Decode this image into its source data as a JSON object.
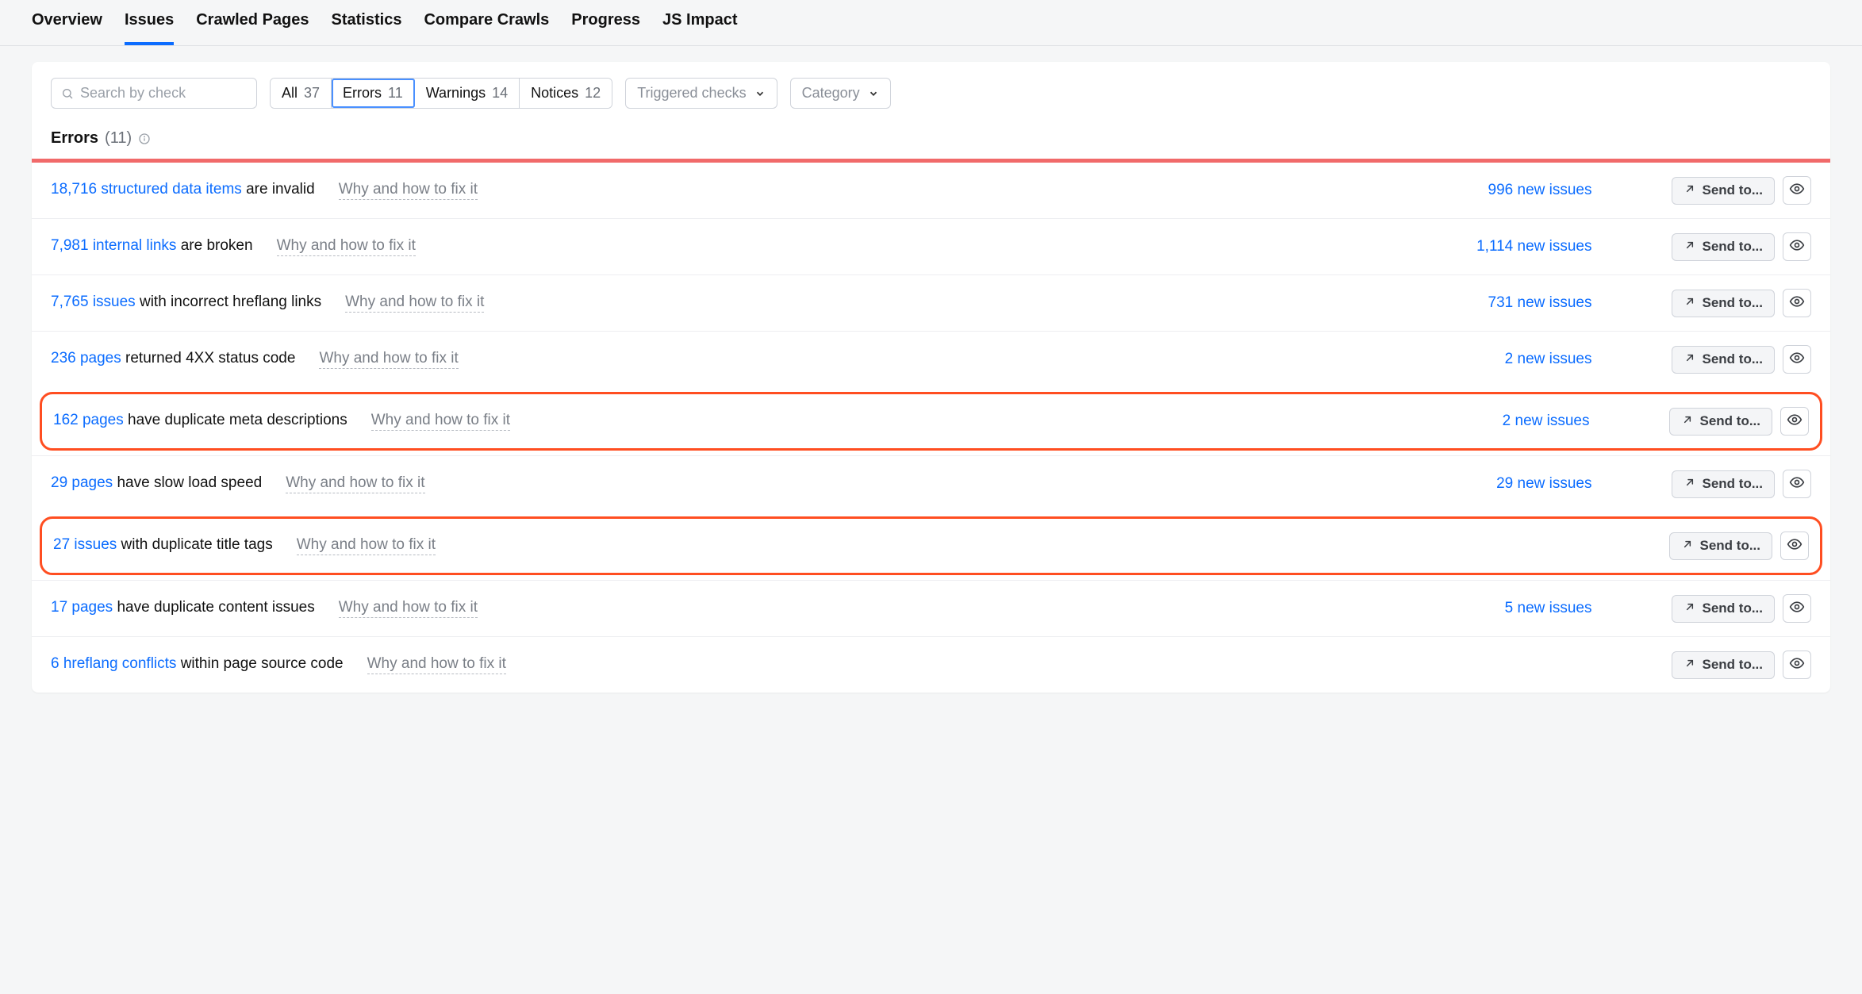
{
  "tabs": [
    {
      "label": "Overview"
    },
    {
      "label": "Issues"
    },
    {
      "label": "Crawled Pages"
    },
    {
      "label": "Statistics"
    },
    {
      "label": "Compare Crawls"
    },
    {
      "label": "Progress"
    },
    {
      "label": "JS Impact"
    }
  ],
  "active_tab": "Issues",
  "toolbar": {
    "search_placeholder": "Search by check",
    "segments": [
      {
        "label": "All",
        "count": "37"
      },
      {
        "label": "Errors",
        "count": "11"
      },
      {
        "label": "Warnings",
        "count": "14"
      },
      {
        "label": "Notices",
        "count": "12"
      }
    ],
    "active_segment": "Errors",
    "dropdown_triggered": "Triggered checks",
    "dropdown_category": "Category"
  },
  "section": {
    "title": "Errors",
    "count": "(11)"
  },
  "common": {
    "hint": "Why and how to fix it",
    "send_to": "Send to..."
  },
  "rows": [
    {
      "link": "18,716 structured data items",
      "rest": " are invalid",
      "new": "996 new issues",
      "hl": false
    },
    {
      "link": "7,981 internal links",
      "rest": " are broken",
      "new": "1,114 new issues",
      "hl": false
    },
    {
      "link": "7,765 issues",
      "rest": " with incorrect hreflang links",
      "new": "731 new issues",
      "hl": false
    },
    {
      "link": "236 pages",
      "rest": " returned 4XX status code",
      "new": "2 new issues",
      "hl": false
    },
    {
      "link": "162 pages",
      "rest": " have duplicate meta descriptions",
      "new": "2 new issues",
      "hl": true
    },
    {
      "link": "29 pages",
      "rest": " have slow load speed",
      "new": "29 new issues",
      "hl": false
    },
    {
      "link": "27 issues",
      "rest": " with duplicate title tags",
      "new": "",
      "hl": true
    },
    {
      "link": "17 pages",
      "rest": " have duplicate content issues",
      "new": "5 new issues",
      "hl": false
    },
    {
      "link": "6 hreflang conflicts",
      "rest": " within page source code",
      "new": "",
      "hl": false
    }
  ]
}
